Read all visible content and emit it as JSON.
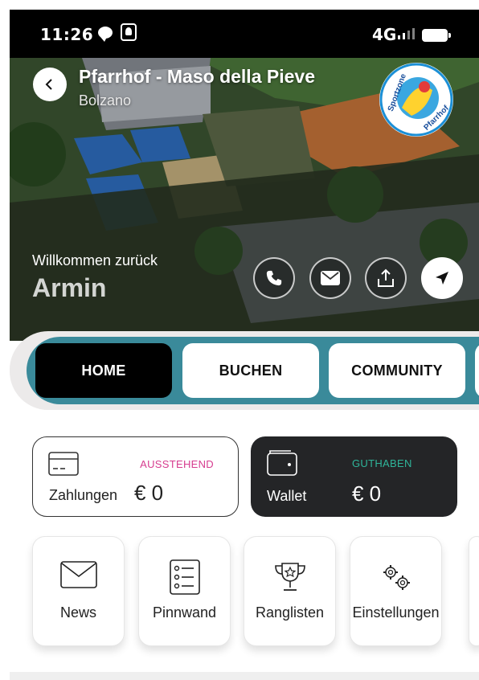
{
  "status_bar": {
    "time": "11:26",
    "network": "4G"
  },
  "header": {
    "club_name": "Pfarrhof - Maso della Pieve",
    "city": "Bolzano"
  },
  "logo_text": "Sportzone Pfarrhof",
  "welcome": {
    "greeting": "Willkommen zurück",
    "user_name": "Armin"
  },
  "action_icons": [
    "phone-icon",
    "mail-icon",
    "share-icon",
    "navigate-icon"
  ],
  "tabs": [
    {
      "label": "HOME",
      "active": true
    },
    {
      "label": "BUCHEN",
      "active": false
    },
    {
      "label": "COMMUNITY",
      "active": false
    }
  ],
  "cards": {
    "payments": {
      "badge": "AUSSTEHEND",
      "label": "Zahlungen",
      "amount": "€ 0"
    },
    "wallet": {
      "badge": "GUTHABEN",
      "label": "Wallet",
      "amount": "€ 0"
    }
  },
  "tiles": [
    {
      "label": "News",
      "icon": "envelope-icon"
    },
    {
      "label": "Pinnwand",
      "icon": "list-icon"
    },
    {
      "label": "Ranglisten",
      "icon": "trophy-icon"
    },
    {
      "label": "Einstellungen",
      "icon": "gears-icon"
    }
  ],
  "colors": {
    "accent_teal": "#3a8a9a",
    "pending_pink": "#d63c8f",
    "credit_green": "#2fb59a",
    "wallet_dark": "#242527"
  }
}
